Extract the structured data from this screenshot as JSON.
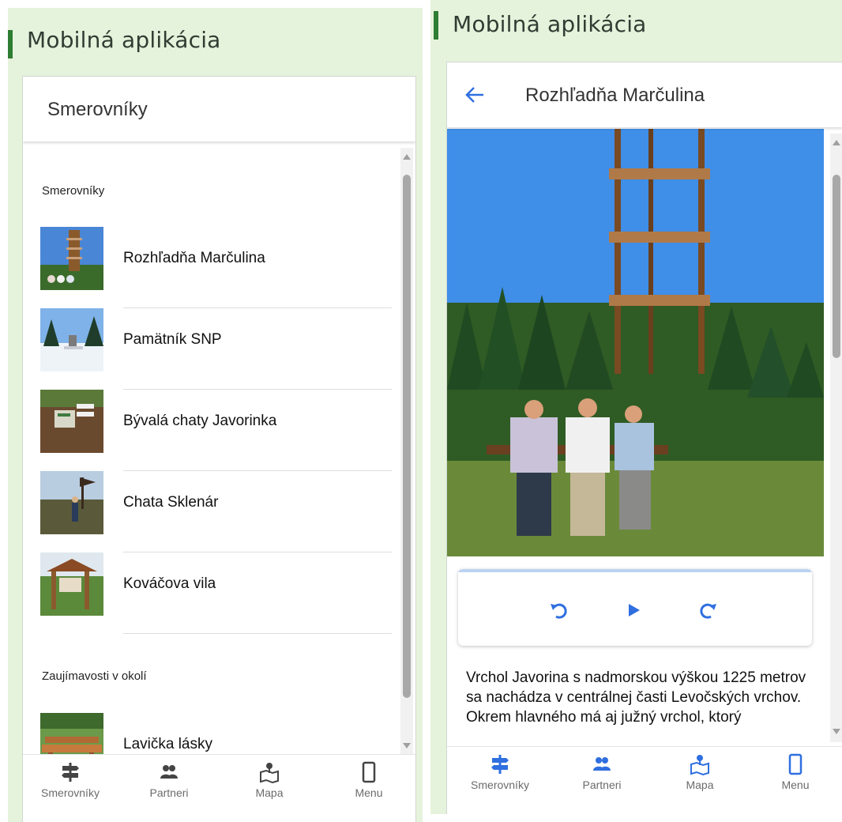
{
  "left": {
    "section_title": "Mobilná aplikácia",
    "header_title": "Smerovníky",
    "groups": [
      {
        "heading": "Smerovníky",
        "items": [
          {
            "label": "Rozhľadňa Marčulina",
            "thumb": "tower"
          },
          {
            "label": "Pamätník SNP",
            "thumb": "snow"
          },
          {
            "label": "Bývalá chaty Javorinka",
            "thumb": "sign"
          },
          {
            "label": "Chata Sklenár",
            "thumb": "hiker"
          },
          {
            "label": "Kováčova vila",
            "thumb": "shelter"
          }
        ]
      },
      {
        "heading": "Zaujímavosti v okolí",
        "items": [
          {
            "label": "Lavička lásky",
            "thumb": "bench"
          }
        ]
      }
    ]
  },
  "right": {
    "section_title": "Mobilná aplikácia",
    "header_title": "Rozhľadňa Marčulina",
    "back_icon": "arrow-left-icon",
    "description": "Vrchol Javorina s nadmorskou výškou 1225 metrov sa nachádza v  centrálnej časti Levočských vrchov. Okrem hlavného má  aj južný vrchol, ktorý"
  },
  "tabs": [
    {
      "label": "Smerovníky",
      "icon": "signpost-icon"
    },
    {
      "label": "Partneri",
      "icon": "people-icon"
    },
    {
      "label": "Mapa",
      "icon": "map-icon"
    },
    {
      "label": "Menu",
      "icon": "phone-icon"
    }
  ],
  "colors": {
    "accent": "#2e7d32",
    "panel_bg": "#e6f3dc",
    "tab_icon": "#2f6fe0",
    "back_arrow": "#2f6fe0"
  }
}
